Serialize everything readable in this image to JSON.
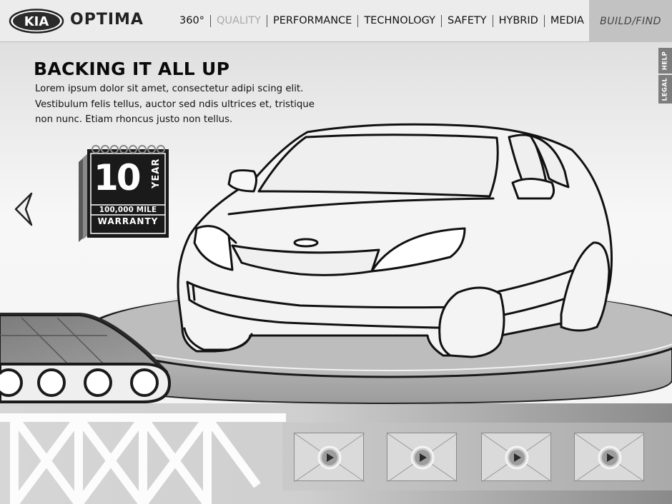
{
  "brand": {
    "logo_text": "KIA",
    "model": "OPTIMA"
  },
  "nav": {
    "items": [
      {
        "label": "360°",
        "state": "active"
      },
      {
        "label": "QUALITY",
        "state": "dim"
      },
      {
        "label": "PERFORMANCE",
        "state": "active"
      },
      {
        "label": "TECHNOLOGY",
        "state": "active"
      },
      {
        "label": "SAFETY",
        "state": "active"
      },
      {
        "label": "HYBRID",
        "state": "active"
      },
      {
        "label": "MEDIA",
        "state": "active"
      }
    ],
    "build_find": "BUILD/FIND"
  },
  "side_tabs": {
    "help": "HELP",
    "legal": "LEGAL"
  },
  "content": {
    "headline": "BACKING IT ALL UP",
    "body_lines": [
      "Lorem ipsum dolor sit amet, consectetur adipi scing elit.",
      "Vestibulum felis tellus, auctor sed ndis ultrices et, tristique",
      "non nunc. Etiam rhoncus justo non tellus."
    ]
  },
  "warranty": {
    "number": "10",
    "unit": "YEAR",
    "miles": "100,000 MILE",
    "label": "WARRANTY"
  },
  "icons": {
    "prev": "chevron-left-icon",
    "play": "play-icon",
    "video": "video-thumbnail-icon"
  },
  "videos": {
    "count": 4
  },
  "colors": {
    "nav_bg": "#ececec",
    "build_find_bg": "#c2c2c2",
    "side_tab_bg": "#7d7d7d",
    "badge_bg": "#1a1a1a",
    "dim_text": "#a9a9a9"
  }
}
